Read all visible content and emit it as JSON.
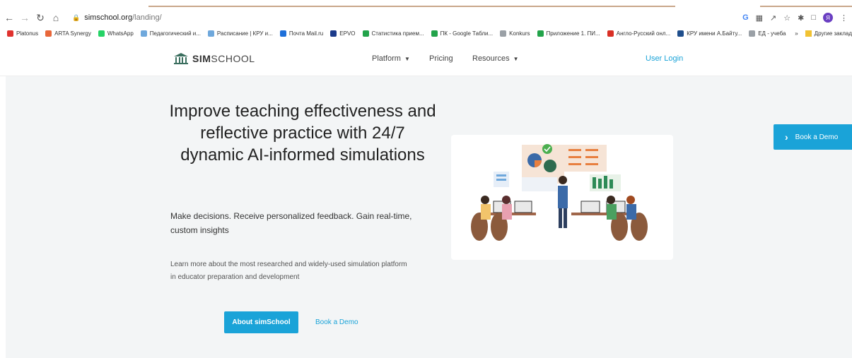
{
  "browser": {
    "url_host": "simschool.org",
    "url_path": "/landing/",
    "profile_initial": "Я",
    "bookmarks": [
      {
        "label": "Platonus",
        "color": "#e0322e"
      },
      {
        "label": "ARTA Synergy",
        "color": "#e8673a"
      },
      {
        "label": "WhatsApp",
        "color": "#25d366"
      },
      {
        "label": "Педагогический и...",
        "color": "#6fa8dc"
      },
      {
        "label": "Расписание | КРУ и...",
        "color": "#6fa8dc"
      },
      {
        "label": "Почта Mail.ru",
        "color": "#1e6fd9"
      },
      {
        "label": "EPVO",
        "color": "#1b3a8a"
      },
      {
        "label": "Статистика прием...",
        "color": "#22a34a"
      },
      {
        "label": "ПК - Google Табли...",
        "color": "#22a34a"
      },
      {
        "label": "Konkurs",
        "color": "#9aa0a6"
      },
      {
        "label": "Приложение 1. ПИ...",
        "color": "#22a34a"
      },
      {
        "label": "Англо-Русский онл...",
        "color": "#d93025"
      },
      {
        "label": "КРУ имени А.Байту...",
        "color": "#1f4e8c"
      },
      {
        "label": "ЕД - учеба",
        "color": "#9aa0a6"
      }
    ],
    "more_label": "»",
    "other_bookmarks": "Другие заклад"
  },
  "site": {
    "logo_bold": "SIM",
    "logo_rest": "SCHOOL",
    "nav": [
      {
        "label": "Platform",
        "caret": true
      },
      {
        "label": "Pricing",
        "caret": false
      },
      {
        "label": "Resources",
        "caret": true
      }
    ],
    "login": "User Login"
  },
  "hero": {
    "headline": "Improve teaching effectiveness and reflective practice with 24/7 dynamic AI-informed simulations",
    "subheadline": "Make decisions. Receive personalized feedback. Gain real-time, custom insights",
    "learn_more": "Learn more about the most researched and widely-used simulation platform in educator preparation and development",
    "about_button": "About simSchool",
    "demo_link": "Book a Demo",
    "float_button": "Book a Demo"
  },
  "colors": {
    "accent": "#1aa3d8",
    "hero_bg": "#f3f5f6"
  }
}
